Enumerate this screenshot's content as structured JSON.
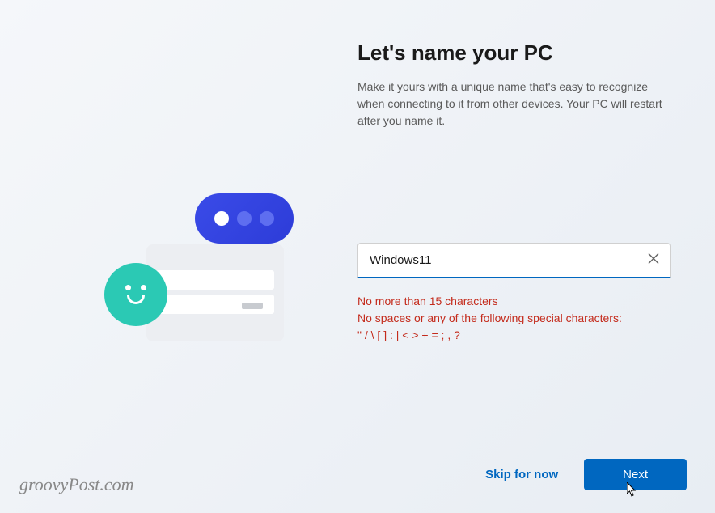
{
  "header": {
    "title": "Let's name your PC",
    "subtitle": "Make it yours with a unique name that's easy to recognize when connecting to it from other devices. Your PC will restart after you name it."
  },
  "input": {
    "value": "Windows11",
    "placeholder": ""
  },
  "validation": {
    "line1": "No more than 15 characters",
    "line2": "No spaces or any of the following special characters:",
    "line3": "\" / \\ [ ] : | < > + = ; , ?"
  },
  "footer": {
    "skip_label": "Skip for now",
    "next_label": "Next"
  },
  "watermark": "groovyPost.com"
}
